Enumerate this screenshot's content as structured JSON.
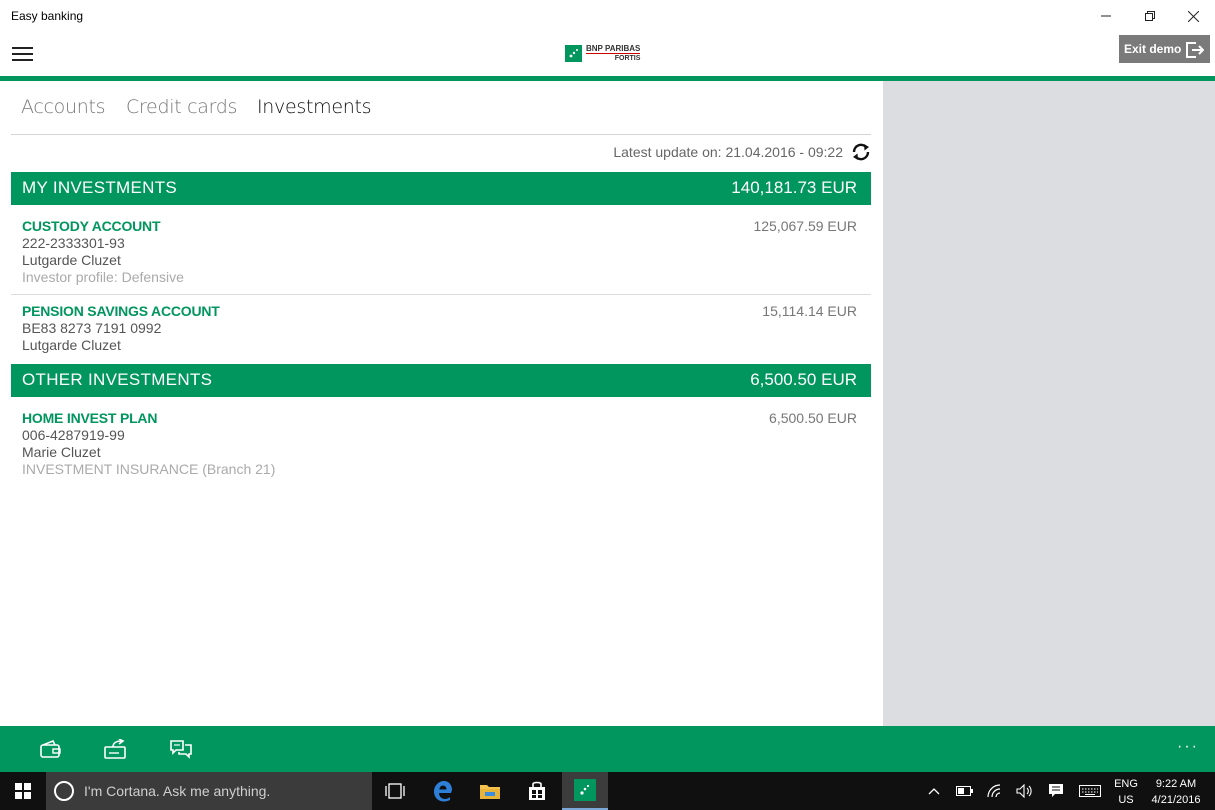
{
  "window": {
    "title": "Easy banking"
  },
  "header": {
    "brand_top": "BNP PARIBAS",
    "brand_bottom": "FORTIS",
    "exit_label": "Exit demo"
  },
  "tabs": [
    {
      "label": "Accounts",
      "active": false
    },
    {
      "label": "Credit cards",
      "active": false
    },
    {
      "label": "Investments",
      "active": true
    }
  ],
  "update": {
    "text": "Latest update on:  21.04.2016 - 09:22"
  },
  "sections": {
    "my": {
      "title": "MY INVESTMENTS",
      "total": "140,181.73 EUR",
      "accounts": [
        {
          "name": "CUSTODY ACCOUNT",
          "amount": "125,067.59 EUR",
          "number": "222-2333301-93",
          "holder": "Lutgarde Cluzet",
          "extra": "Investor profile: Defensive"
        },
        {
          "name": "PENSION SAVINGS ACCOUNT",
          "amount": "15,114.14 EUR",
          "number": "BE83 8273 7191 0992",
          "holder": "Lutgarde Cluzet"
        }
      ]
    },
    "other": {
      "title": "OTHER INVESTMENTS",
      "total": "6,500.50 EUR",
      "accounts": [
        {
          "name": "HOME INVEST PLAN",
          "amount": "6,500.50 EUR",
          "number": "006-4287919-99",
          "holder": "Marie Cluzet",
          "extra": "INVESTMENT INSURANCE (Branch 21)"
        }
      ]
    }
  },
  "appbar": {
    "more": "···"
  },
  "taskbar": {
    "cortana_placeholder": "I'm Cortana. Ask me anything.",
    "lang_top": "ENG",
    "lang_bottom": "US",
    "time": "9:22 AM",
    "date": "4/21/2016"
  },
  "colors": {
    "brand_green": "#00965e",
    "side_panel": "#dcdde1",
    "taskbar": "#101010"
  }
}
